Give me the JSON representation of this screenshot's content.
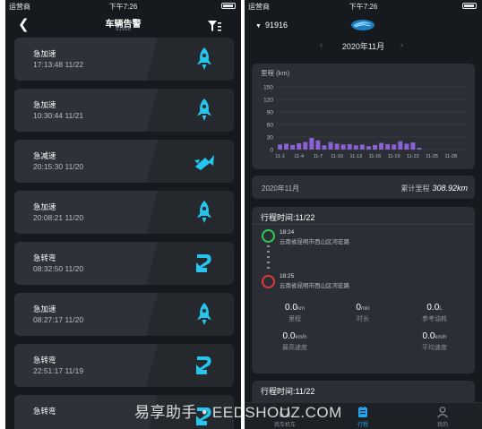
{
  "left": {
    "status": {
      "carrier": "运营商",
      "time": "下午7:26"
    },
    "header": {
      "title": "车辆告警",
      "subtitle": "91916"
    },
    "alerts": [
      {
        "name": "急加速",
        "time": "17:13:48 11/22",
        "icon": "rocket-icon"
      },
      {
        "name": "急加速",
        "time": "10:30:44 11/21",
        "icon": "rocket-icon"
      },
      {
        "name": "急减速",
        "time": "20:15:30 11/20",
        "icon": "brake-icon"
      },
      {
        "name": "急加速",
        "time": "20:08:21 11/20",
        "icon": "rocket-icon"
      },
      {
        "name": "急转弯",
        "time": "08:32:50 11/20",
        "icon": "turn-icon"
      },
      {
        "name": "急加速",
        "time": "08:27:17 11/20",
        "icon": "rocket-icon"
      },
      {
        "name": "急转弯",
        "time": "22:51:17 11/19",
        "icon": "turn-icon"
      },
      {
        "name": "急转弯",
        "time": "",
        "icon": "turn-icon"
      }
    ]
  },
  "right": {
    "status": {
      "carrier": "运营商",
      "time": "下午7:26"
    },
    "vehicle": "91916",
    "month_nav": {
      "prev": "‹",
      "current": "2020年11月",
      "next": "›"
    },
    "summary": {
      "month": "2020年11月",
      "total_label": "累计里程",
      "total_value": "308.92km"
    },
    "trip": {
      "title": "行程时间:11/22",
      "start": {
        "time": "18:24",
        "address": "云南省昆明市西山区河宏路"
      },
      "end": {
        "time": "18:25",
        "address": "云南省昆明市西山区河宏路"
      },
      "stats": [
        {
          "value": "0.0",
          "unit": "km",
          "label": "里程"
        },
        {
          "value": "0",
          "unit": "min",
          "label": "时长"
        },
        {
          "value": "0.0",
          "unit": "L",
          "label": "参考油耗"
        },
        {
          "value": "0.0",
          "unit": "km/h",
          "label": "最高速度"
        },
        {
          "value": "0.0",
          "unit": "km/h",
          "label": "平均速度"
        }
      ]
    },
    "trip2_title": "行程时间:11/22",
    "tabs": [
      {
        "label": "我车机车"
      },
      {
        "label": "行程"
      },
      {
        "label": "我的"
      }
    ],
    "colors": {
      "accent": "#23a7f0",
      "bar": "#8a62d6",
      "start": "#2ecc55",
      "end": "#e0393c"
    }
  },
  "chart_data": {
    "type": "bar",
    "title": "里程 (km)",
    "categories": [
      "11-1",
      "11-2",
      "11-3",
      "11-4",
      "11-5",
      "11-6",
      "11-7",
      "11-8",
      "11-9",
      "11-10",
      "11-11",
      "11-12",
      "11-13",
      "11-14",
      "11-15",
      "11-16",
      "11-17",
      "11-18",
      "11-19",
      "11-20",
      "11-21",
      "11-22",
      "11-23",
      "11-24",
      "11-25",
      "11-26",
      "11-27",
      "11-28",
      "11-29",
      "11-30"
    ],
    "tick_labels": [
      "11-1",
      "11-4",
      "11-7",
      "11-10",
      "11-13",
      "11-16",
      "11-19",
      "11-22",
      "11-25",
      "11-28"
    ],
    "values": [
      12,
      14,
      11,
      15,
      18,
      28,
      22,
      10,
      18,
      14,
      12,
      13,
      10,
      12,
      8,
      11,
      16,
      13,
      12,
      20,
      14,
      17,
      4,
      0,
      0,
      0,
      0,
      0,
      0,
      0
    ],
    "ylim": [
      0,
      150
    ],
    "yticks": [
      0,
      30,
      60,
      90,
      120,
      150
    ],
    "grid": true
  },
  "watermark": "易享助手 • EEDSHOUZ.COM"
}
